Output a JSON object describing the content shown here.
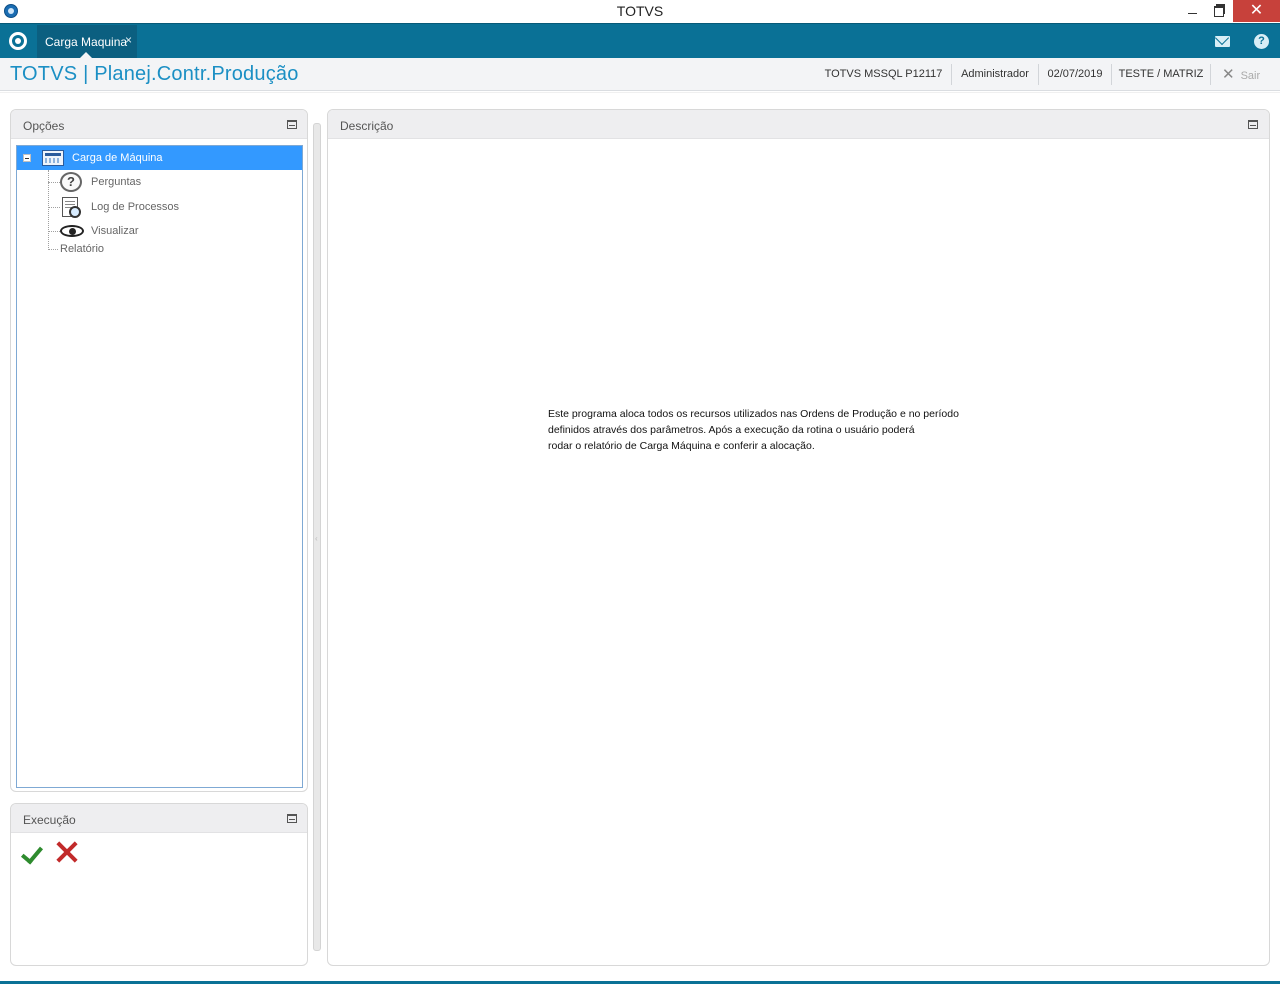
{
  "window": {
    "title": "TOTVS",
    "close_glyph": "✕"
  },
  "tabbar": {
    "tabs": [
      {
        "label": "Carga Maquina",
        "close_glyph": "×"
      }
    ]
  },
  "header": {
    "brand": "TOTVS | Planej.Contr.Produção",
    "environment": "TOTVS  MSSQL P12117",
    "user": "Administrador",
    "date": "02/07/2019",
    "company": "TESTE / MATRIZ",
    "exit_label": "Sair",
    "exit_glyph": "✕"
  },
  "options_panel": {
    "title": "Opções",
    "tree": {
      "root_label": "Carga de Máquina",
      "children": [
        {
          "label": "Perguntas",
          "icon": "question-icon"
        },
        {
          "label": "Log de Processos",
          "icon": "log-icon"
        },
        {
          "label": "Visualizar",
          "icon": "eye-icon"
        }
      ],
      "sibling_label": "Relatório"
    }
  },
  "execution_panel": {
    "title": "Execução",
    "buttons": [
      {
        "icon": "checkmark-icon",
        "color": "#2e8b2e"
      },
      {
        "icon": "cancel-x-icon",
        "color": "#c22a2a"
      }
    ]
  },
  "description_panel": {
    "title": "Descrição",
    "text": "Este programa aloca todos os recursos utilizados nas Ordens de Produção e no período\ndefinidos através dos parâmetros. Após a execução da rotina o usuário poderá\nrodar o relatório de Carga Máquina e conferir a alocação."
  },
  "colors": {
    "accent": "#0a7196",
    "brand_text": "#1b8fc4",
    "selection": "#3399ff",
    "close_button": "#c7413b"
  }
}
